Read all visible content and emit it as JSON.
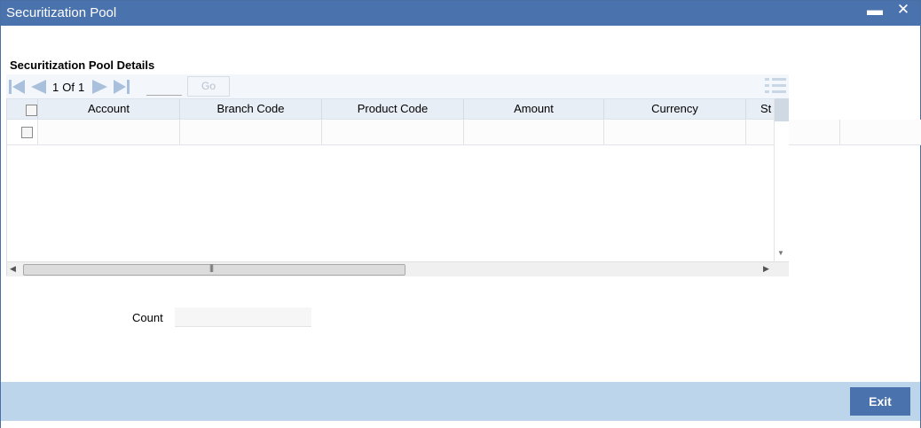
{
  "window": {
    "title": "Securitization Pool",
    "minimize_label": "▬",
    "close_label": "✕"
  },
  "section": {
    "title": "Securitization Pool Details"
  },
  "pagination": {
    "current": "1",
    "of_label": "Of",
    "total": "1",
    "page_value": "",
    "go_label": "Go"
  },
  "table": {
    "columns": [
      "Account",
      "Branch Code",
      "Product Code",
      "Amount",
      "Currency",
      "St"
    ]
  },
  "count": {
    "label": "Count",
    "value": ""
  },
  "footer": {
    "exit_label": "Exit"
  },
  "colors": {
    "titlebar": "#4a72ad",
    "footer": "#bcd5ea",
    "header_row": "#e8eef6",
    "nav_disabled": "#a9c0dc"
  },
  "icons": {
    "first": "first-page-icon",
    "prev": "previous-page-icon",
    "next": "next-page-icon",
    "last": "last-page-icon",
    "list": "column-list-icon"
  }
}
